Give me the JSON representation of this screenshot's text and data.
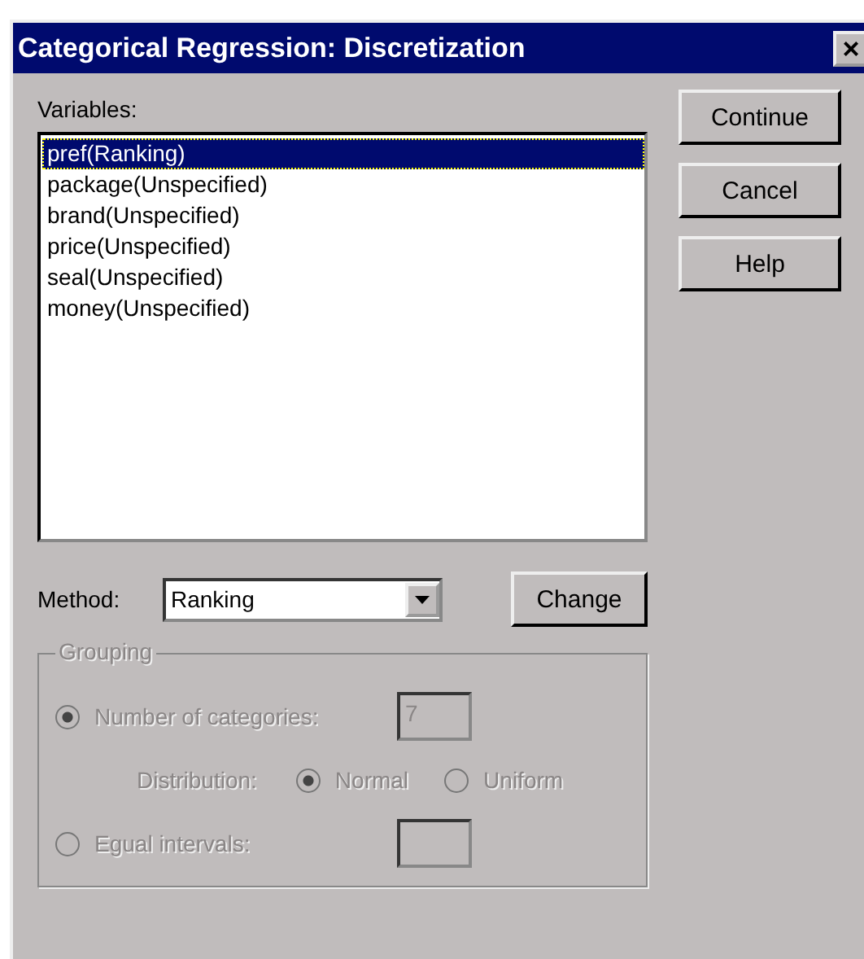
{
  "window": {
    "title": "Categorical Regression: Discretization",
    "close": "×"
  },
  "variables": {
    "label": "Variables:",
    "items": [
      {
        "text": "pref(Ranking)",
        "selected": true
      },
      {
        "text": "package(Unspecified)",
        "selected": false
      },
      {
        "text": "brand(Unspecified)",
        "selected": false
      },
      {
        "text": "price(Unspecified)",
        "selected": false
      },
      {
        "text": "seal(Unspecified)",
        "selected": false
      },
      {
        "text": "money(Unspecified)",
        "selected": false
      }
    ]
  },
  "buttons": [
    "Continue",
    "Cancel",
    "Help"
  ],
  "method": {
    "label": "Method:",
    "value": "Ranking",
    "change": "Change"
  },
  "grouping": {
    "title": "Grouping",
    "disabled": true,
    "number": {
      "label": "Number of categories:",
      "selected": true,
      "value": "7"
    },
    "distribution": {
      "label": "Distribution:",
      "options": [
        {
          "label": "Normal",
          "selected": true
        },
        {
          "label": "Uniform",
          "selected": false
        }
      ]
    },
    "equal": {
      "label": "Egual intervals:",
      "selected": false
    }
  }
}
